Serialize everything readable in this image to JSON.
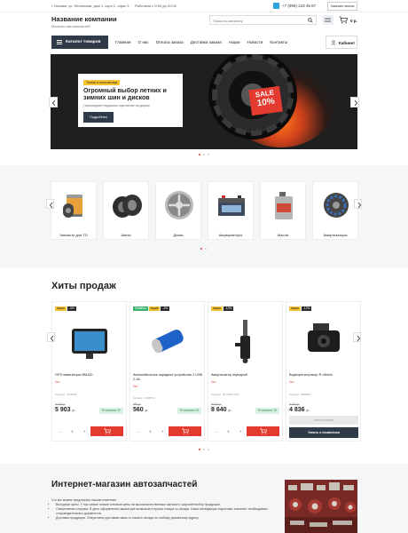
{
  "topbar": {
    "address": "г. Москва, ул. Ленинская, дом 1, корп 2, офис 3",
    "hours": "Работаем с 9:00 до 20:00",
    "phone": "+7 (999) 123 45 67",
    "callback_label": "Заказать звонок"
  },
  "header": {
    "company_name": "Название компании",
    "company_tagline": "Магазин автозапчастей",
    "search_placeholder": "Поиск по каталогу",
    "cart_total": "0 р."
  },
  "nav": {
    "catalog_label": "Каталог товаров",
    "items": [
      "Главная",
      "О нас",
      "Оплата заказа",
      "Доставка заказа",
      "Акции",
      "Новости",
      "Контакты"
    ],
    "cabinet_label": "Кабинет"
  },
  "hero": {
    "tag": "Только в этом месяце",
    "title": "Огромный выбор летних и зимних шин и дисков",
    "subtitle": "Гарантируют надежное сцепление на дороге",
    "button": "Подробнее",
    "sale_word": "SALE",
    "sale_value": "10%"
  },
  "categories": [
    {
      "label": "Запчасти для ТО",
      "icon": "oil-filter-icon"
    },
    {
      "label": "Шины",
      "icon": "tires-icon"
    },
    {
      "label": "Диски",
      "icon": "rim-icon"
    },
    {
      "label": "Аккумуляторы",
      "icon": "battery-icon"
    },
    {
      "label": "Масла",
      "icon": "oil-can-icon"
    },
    {
      "label": "Амортизаторы",
      "icon": "shock-absorber-icon"
    }
  ],
  "bestsellers": {
    "title": "Хиты продаж",
    "products": [
      {
        "badges": [
          {
            "text": "Акция",
            "color": "yellow"
          },
          {
            "text": "-4%",
            "color": "dark"
          }
        ],
        "name": "GPS навигаторы BM100",
        "availability": "Хит",
        "article": "Артикул: 2348468",
        "old_price": "6 210 р.",
        "price": "5 903",
        "currency": "р.",
        "stock": "В наличии: 57",
        "qty": "1",
        "icon": "gps-navigator-icon"
      },
      {
        "badges": [
          {
            "text": "Новинка",
            "color": "green"
          },
          {
            "text": "Акция",
            "color": "yellow"
          },
          {
            "text": "-3%",
            "color": "dark"
          }
        ],
        "name": "Автомобильное зарядное устройство 2 USB 2.1А",
        "availability": "Хит",
        "article": "Артикул: 1488794",
        "old_price": "580 р.",
        "price": "560",
        "currency": "р.",
        "stock": "В наличии: 64",
        "qty": "1",
        "icon": "usb-charger-icon"
      },
      {
        "badges": [
          {
            "text": "Акция",
            "color": "yellow"
          },
          {
            "text": "-10%",
            "color": "dark"
          }
        ],
        "name": "Амортизатор передний",
        "availability": "Хит",
        "article": "Артикул: 0571287/1227",
        "old_price": "9 600 р.",
        "price": "8 640",
        "currency": "р.",
        "stock": "В наличии: 25",
        "qty": "1",
        "icon": "shock-absorber-icon"
      },
      {
        "badges": [
          {
            "text": "Акция",
            "color": "yellow"
          },
          {
            "text": "-12%",
            "color": "dark"
          }
        ],
        "name": "Видеорегистратор R-46mini",
        "availability": "Хит",
        "article": "Артикул: 3686507",
        "old_price": "5 490 р.",
        "price": "4 836",
        "currency": "р.",
        "stock_alt": "Нет в наличии",
        "notify": "Узнать о появлении",
        "icon": "dashcam-icon"
      }
    ]
  },
  "about": {
    "title": "Интернет-магазин автозапчастей",
    "intro": "Что мы можем предложить нашим клиентам:",
    "bullets": [
      "Выгодные цены. У нас самые низкие оптовые цены на высококачественные запчасти, широкий выбор продукции.",
      "Оперативная отгрузка. В день оформления заказа уже возможна отгрузка товара со склада. Наши менеджеры подготовят комплект необходимых сопроводительных документов.",
      "Доставка продукции. Оперативно доставим заказ от нашего склада по любому указанному адресу."
    ]
  }
}
